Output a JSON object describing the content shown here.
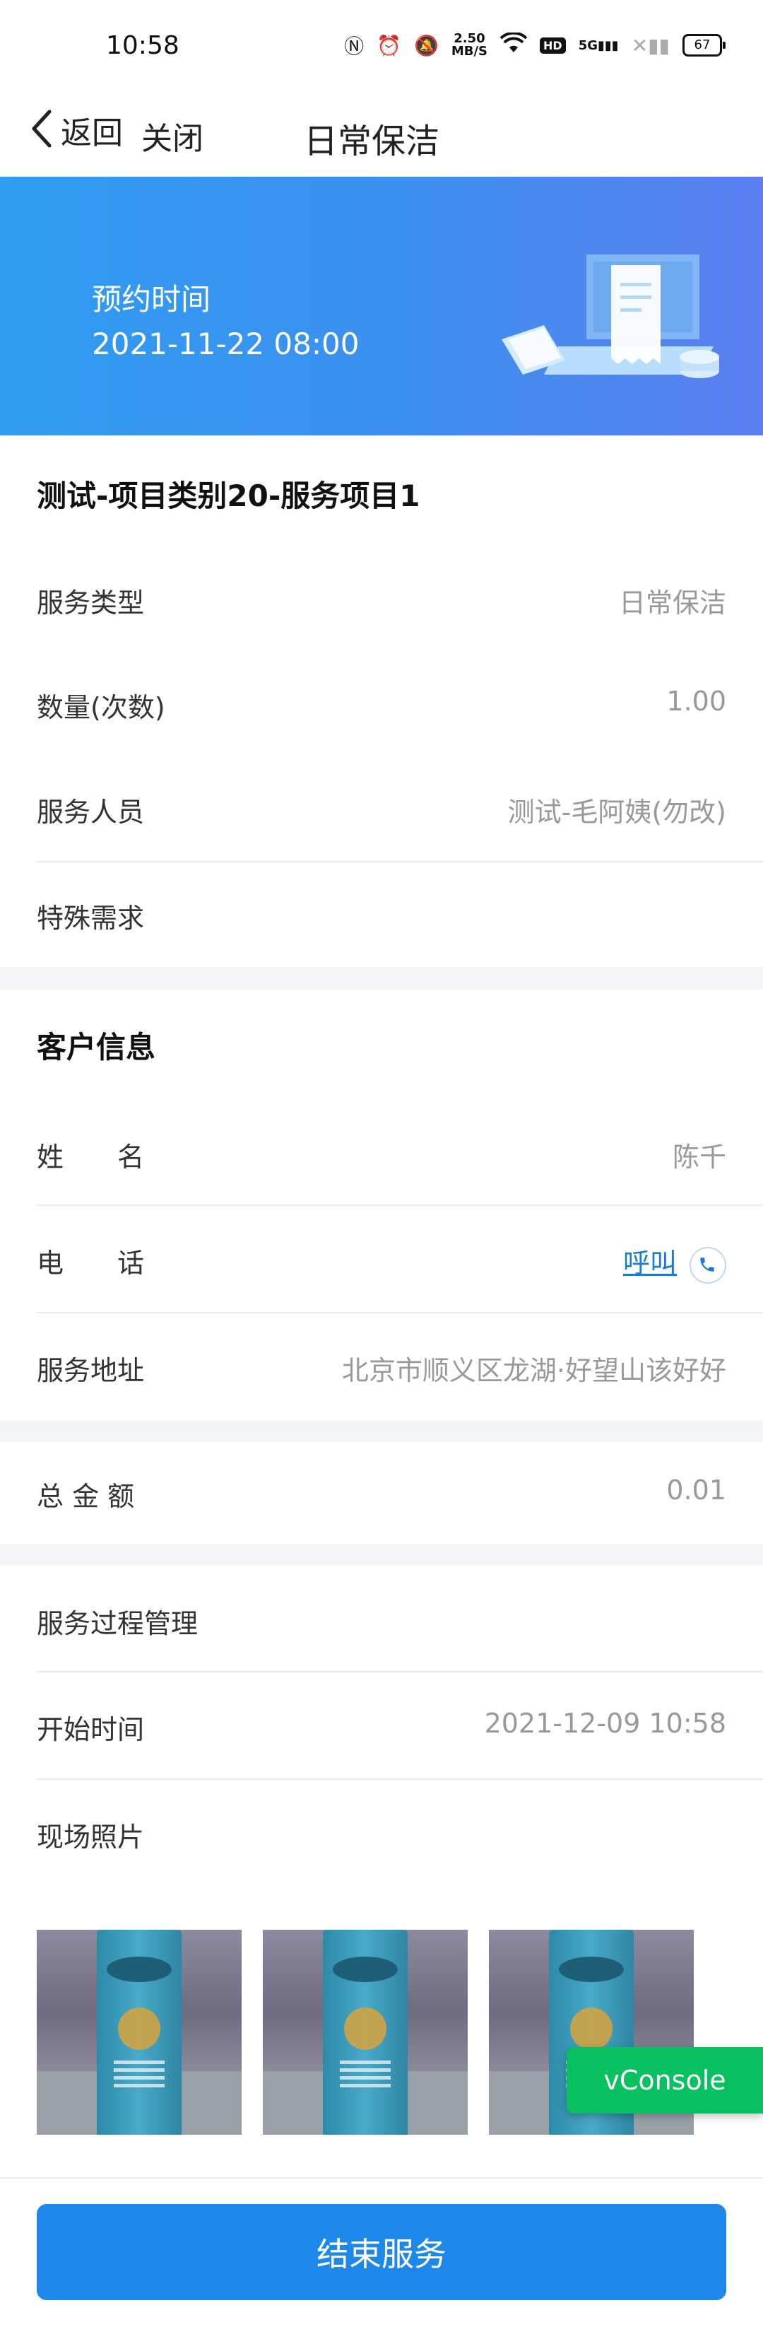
{
  "status_bar": {
    "time": "10:58",
    "speed": "2.50",
    "speed_unit": "MB/S",
    "network": "5G",
    "battery": "67"
  },
  "nav": {
    "back_label": "返回",
    "close_label": "关闭",
    "title": "日常保洁"
  },
  "banner": {
    "label": "预约时间",
    "value": "2021-11-22 08:00"
  },
  "service": {
    "title": "测试-项目类别20-服务项目1",
    "rows": [
      {
        "label": "服务类型",
        "value": "日常保洁"
      },
      {
        "label": "数量(次数)",
        "value": "1.00"
      },
      {
        "label": "服务人员",
        "value": "测试-毛阿姨(勿改)"
      },
      {
        "label": "特殊需求",
        "value": ""
      }
    ]
  },
  "customer": {
    "title": "客户信息",
    "name_label": "姓　　名",
    "name_value": "陈千",
    "phone_label": "电　　话",
    "phone_action": "呼叫",
    "address_label": "服务地址",
    "address_value": "北京市顺义区龙湖·好望山该好好"
  },
  "amount": {
    "label": "总 金 额",
    "value": "0.01"
  },
  "process": {
    "title": "服务过程管理",
    "start_label": "开始时间",
    "start_value": "2021-12-09 10:58",
    "photos_label": "现场照片",
    "photo_count": 3
  },
  "vconsole_label": "vConsole",
  "footer": {
    "end_button": "结束服务"
  },
  "colors": {
    "primary": "#1e88ea",
    "banner_start": "#2f9df0",
    "banner_end": "#5b7ff0",
    "vconsole": "#07c160",
    "link": "#1a7ad8"
  }
}
